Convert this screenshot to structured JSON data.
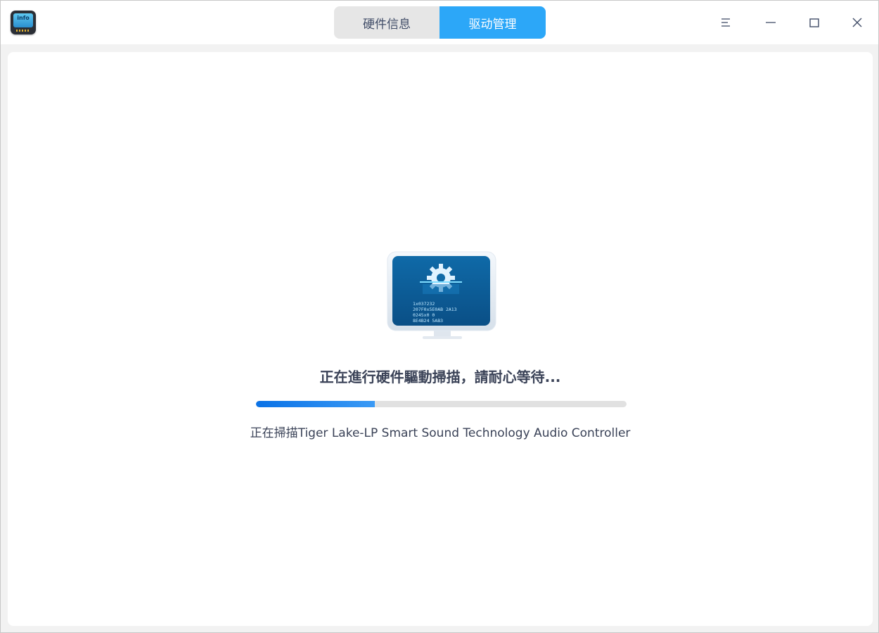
{
  "titlebar": {
    "app_icon_label": "info",
    "tabs": [
      {
        "label": "硬件信息",
        "active": false
      },
      {
        "label": "驱动管理",
        "active": true
      }
    ],
    "controls": {
      "menu_icon": "menu-icon",
      "minimize_icon": "minimize-icon",
      "maximize_icon": "maximize-icon",
      "close_icon": "close-icon"
    }
  },
  "scan": {
    "illustration_icon": "monitor-gear-icon",
    "screen_code_lines": [
      "1x037232",
      "207F0x5E0AB  2A13",
      "0245x0 0",
      "8E4B24 5AB3"
    ],
    "title": "正在進行硬件驅動掃描，請耐心等待...",
    "progress_fraction": 0.32,
    "detail": "正在掃描Tiger Lake-LP Smart Sound Technology Audio Controller"
  },
  "colors": {
    "accent": "#2ca7f8",
    "progress": "#0a72e6",
    "text": "#3a4257"
  }
}
